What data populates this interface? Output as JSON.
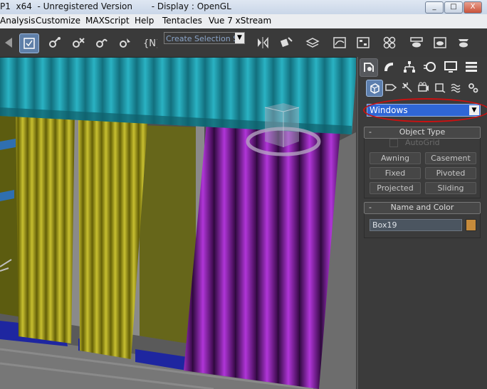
{
  "window": {
    "title": "P1  x64  - Unregistered Version       - Display : OpenGL",
    "controls": [
      "_",
      "□",
      "X"
    ]
  },
  "menu": {
    "items": [
      "Analysis",
      "Customize",
      "MAXScript",
      "Help",
      "Tentacles",
      "Vue 7 xStream"
    ]
  },
  "toolbar": {
    "selection_set_placeholder": "Create Selection Se",
    "named_sets_label": "{N}"
  },
  "command_panel": {
    "category_dropdown": {
      "selected": "Windows"
    },
    "object_type": {
      "title": "Object Type",
      "autogrid_label": "AutoGrid",
      "autogrid_checked": false,
      "buttons": [
        "Awning",
        "Casement",
        "Fixed",
        "Pivoted",
        "Projected",
        "Sliding"
      ]
    },
    "name_and_color": {
      "title": "Name and Color",
      "object_name": "Box19",
      "object_color": "#c78b3b"
    },
    "rollout_collapse_symbol": "-"
  },
  "colors": {
    "accent_selection": "#2f66d6",
    "highlight_ring": "#cc1010",
    "valance_teal": "#1f8fa0",
    "curtain_yellow": "#a8a018",
    "curtain_purple": "#8a1fb0"
  }
}
